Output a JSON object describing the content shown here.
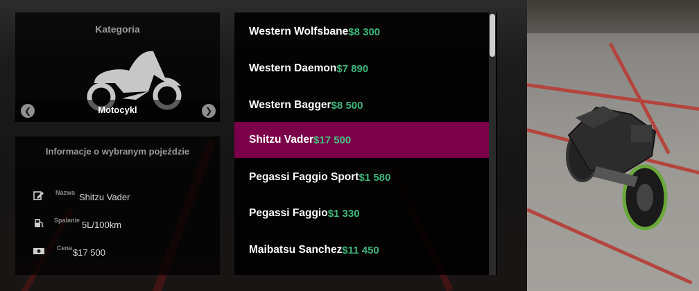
{
  "category_panel": {
    "title": "Kategoria",
    "current": "Motocykl",
    "icon": "motorcycle-icon",
    "prev_icon": "chevron-left-icon",
    "next_icon": "chevron-right-icon"
  },
  "info_panel": {
    "title": "Informacje o wybranym pojeździe",
    "rows": [
      {
        "label": "Nazwa",
        "value": "Shitzu Vader",
        "icon": "edit-icon"
      },
      {
        "label": "Spalanie",
        "value": "5L/100km",
        "icon": "fuel-icon"
      },
      {
        "label": "Cena",
        "value": "$17 500",
        "icon": "banknote-icon"
      }
    ]
  },
  "vehicle_list": {
    "items": [
      {
        "name": "Western Wolfsbane",
        "price": "$8 300",
        "selected": false
      },
      {
        "name": "Western Daemon",
        "price": "$7 890",
        "selected": false
      },
      {
        "name": "Western Bagger",
        "price": "$8 500",
        "selected": false
      },
      {
        "name": "Shitzu Vader",
        "price": "$17 500",
        "selected": true
      },
      {
        "name": "Pegassi Faggio Sport",
        "price": "$1 580",
        "selected": false
      },
      {
        "name": "Pegassi Faggio",
        "price": "$1 330",
        "selected": false
      },
      {
        "name": "Maibatsu Sanchez",
        "price": "$11 450",
        "selected": false
      }
    ],
    "selected_color": "#7a0049",
    "price_color": "#3fb67a"
  }
}
